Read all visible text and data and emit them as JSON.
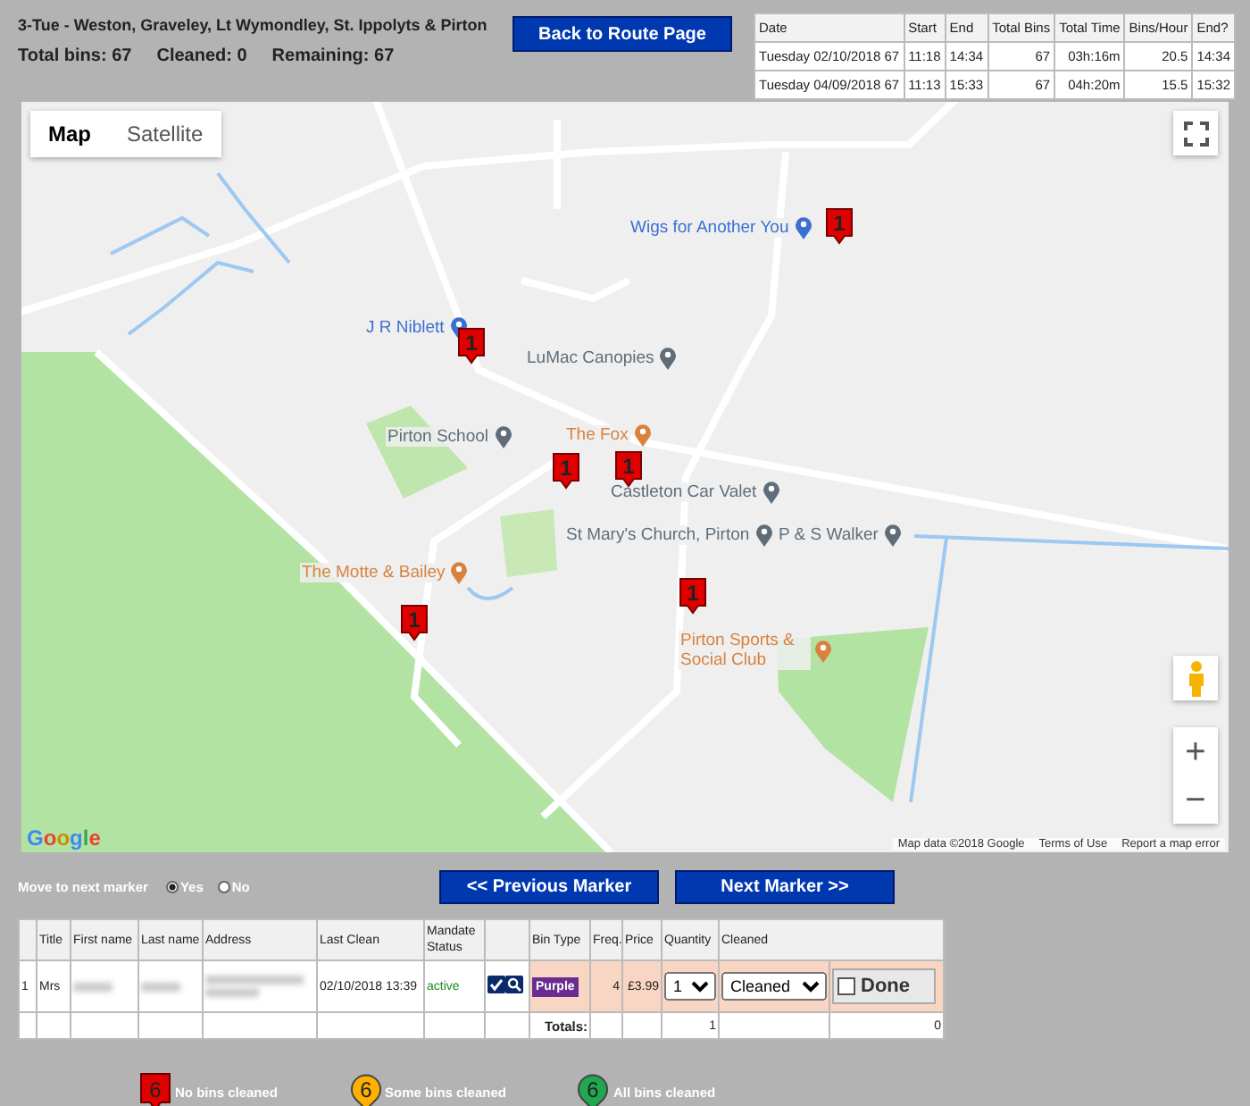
{
  "route": {
    "title": "3-Tue - Weston, Graveley, Lt Wymondley, St. Ippolyts & Pirton",
    "stats": [
      "Total bins: 67",
      "Cleaned: 0",
      "Remaining: 67"
    ]
  },
  "back_button": "Back to Route Page",
  "history": {
    "columns": [
      "Date",
      "Start",
      "End",
      "Total Bins",
      "Total Time",
      "Bins/Hour",
      "End?"
    ],
    "rows": [
      [
        "Tuesday 02/10/2018 67",
        "11:18",
        "14:34",
        "67",
        "03h:16m",
        "20.5",
        "14:34"
      ],
      [
        "Tuesday 04/09/2018 67",
        "11:13",
        "15:33",
        "67",
        "04h:20m",
        "15.5",
        "15:32"
      ]
    ]
  },
  "map": {
    "tabs": [
      {
        "label": "Map",
        "selected": true
      },
      {
        "label": "Satellite",
        "selected": false
      }
    ],
    "places": [
      {
        "label": "Wigs for Another You",
        "kind": "shop"
      },
      {
        "label": "J R Niblett",
        "kind": "shop"
      },
      {
        "label": "LuMac Canopies",
        "kind": "business"
      },
      {
        "label": "Pirton School",
        "kind": "business"
      },
      {
        "label": "The Fox",
        "kind": "food"
      },
      {
        "label": "Castleton Car Valet",
        "kind": "business"
      },
      {
        "label": "St Mary's Church, Pirton",
        "kind": "business"
      },
      {
        "label": "P & S Walker",
        "kind": "business"
      },
      {
        "label": "The Motte & Bailey",
        "kind": "food"
      },
      {
        "label": "Pirton Sports & Social Club",
        "kind": "food"
      }
    ],
    "markers": [
      {
        "label": "1",
        "color": "#e00000"
      },
      {
        "label": "1",
        "color": "#e00000"
      },
      {
        "label": "1",
        "color": "#e00000"
      },
      {
        "label": "1",
        "color": "#e00000"
      },
      {
        "label": "1",
        "color": "#e00000"
      },
      {
        "label": "1",
        "color": "#e00000"
      }
    ],
    "zoom_in": "+",
    "zoom_out": "−",
    "logo": "Google",
    "attribution": [
      "Map data ©2018 Google",
      "Terms of Use",
      "Report a map error"
    ]
  },
  "move_next": {
    "label": "Move to next marker",
    "options": [
      {
        "label": "Yes",
        "selected": true
      },
      {
        "label": "No",
        "selected": false
      }
    ]
  },
  "nav_buttons": [
    "<< Previous Marker",
    "Next Marker >>"
  ],
  "table": {
    "columns": [
      "Title",
      "First name",
      "Last name",
      "Address",
      "Last Clean",
      "Mandate Status",
      "Bin Type",
      "Freq.",
      "Price",
      "Quantity",
      "Cleaned"
    ],
    "row": {
      "index": "1",
      "title": "Mrs",
      "last_clean": "02/10/2018 13:39",
      "mandate": "active",
      "bin_type": "Purple",
      "freq": "4",
      "price": "£3.99",
      "quantity": "1",
      "cleaned": "Cleaned",
      "done": {
        "label": "Done",
        "checked": false
      }
    },
    "totals": {
      "label": "Totals:",
      "quantity": "1",
      "done": "0"
    }
  },
  "legend": [
    {
      "label": "No bins cleaned",
      "number": "6",
      "color": "#e00000"
    },
    {
      "label": "Some bins cleaned",
      "number": "6",
      "color": "#ffb000"
    },
    {
      "label": "All bins cleaned",
      "number": "6",
      "color": "#1fa84f"
    }
  ]
}
